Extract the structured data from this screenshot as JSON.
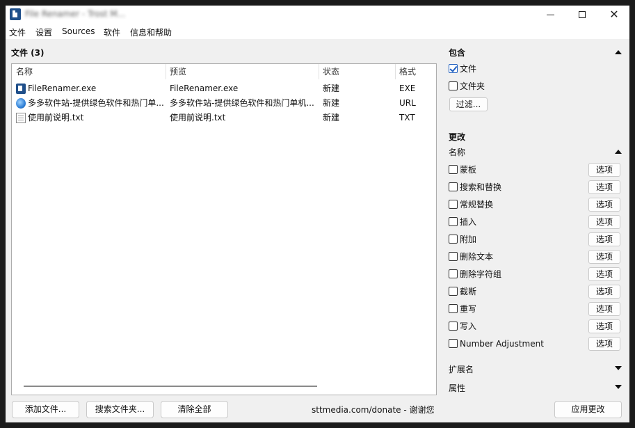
{
  "window": {
    "title": "File Renamer - Trost M..."
  },
  "menu": [
    "文件",
    "设置",
    "Sources",
    "软件",
    "信息和帮助"
  ],
  "files_section": {
    "title": "文件 (3)",
    "columns": [
      "名称",
      "预览",
      "状态",
      "格式"
    ],
    "rows": [
      {
        "icon": "exe-icon",
        "name": "FileRenamer.exe",
        "preview": "FileRenamer.exe",
        "status": "新建",
        "format": "EXE"
      },
      {
        "icon": "globe-url-icon",
        "name": "多多软件站-提供绿色软件和热门单...",
        "preview": "多多软件站-提供绿色软件和热门单机...",
        "status": "新建",
        "format": "URL"
      },
      {
        "icon": "text-file-icon",
        "name": "使用前说明.txt",
        "preview": "使用前说明.txt",
        "status": "新建",
        "format": "TXT"
      }
    ]
  },
  "bottom": {
    "add_files": "添加文件...",
    "search_folder": "搜索文件夹...",
    "clear_all": "清除全部",
    "donate": "sttmedia.com/donate - 谢谢您",
    "apply": "应用更改"
  },
  "include": {
    "title": "包含",
    "files_label": "文件",
    "files_checked": true,
    "folders_label": "文件夹",
    "folders_checked": false,
    "filter_button": "过滤..."
  },
  "change": {
    "title": "更改",
    "name_title": "名称",
    "option_label": "选项",
    "items": [
      {
        "label": "蒙板",
        "checked": false
      },
      {
        "label": "搜索和替换",
        "checked": false
      },
      {
        "label": "常规替换",
        "checked": false
      },
      {
        "label": "插入",
        "checked": false
      },
      {
        "label": "附加",
        "checked": false
      },
      {
        "label": "删除文本",
        "checked": false
      },
      {
        "label": "删除字符组",
        "checked": false
      },
      {
        "label": "截断",
        "checked": false
      },
      {
        "label": "重写",
        "checked": false
      },
      {
        "label": "写入",
        "checked": false
      },
      {
        "label": "Number Adjustment",
        "checked": false
      }
    ],
    "extension_title": "扩展名",
    "attributes_title": "属性"
  }
}
